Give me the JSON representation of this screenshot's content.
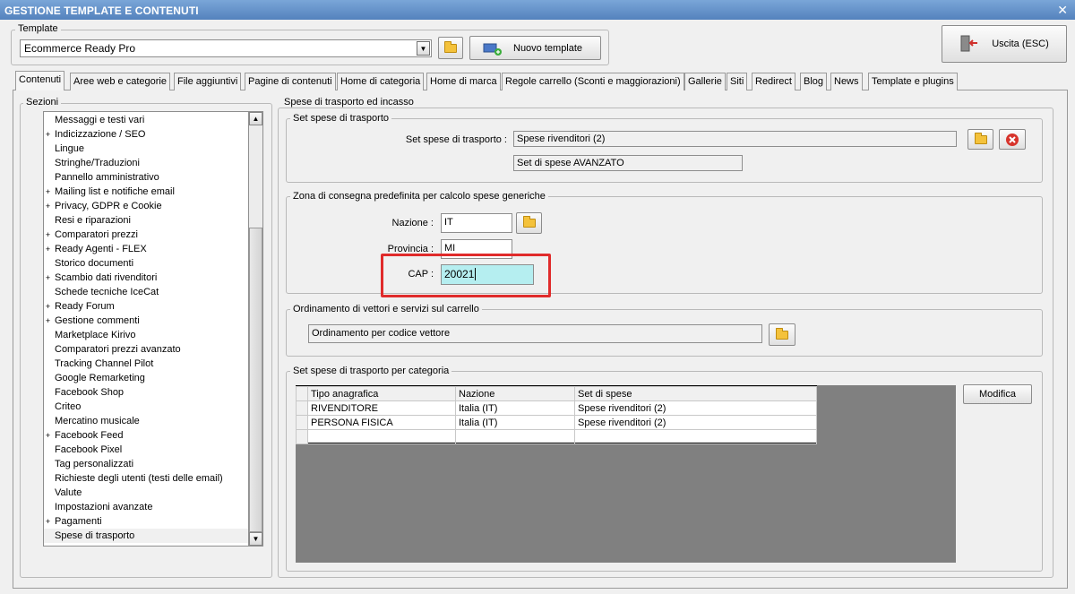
{
  "window": {
    "title": "GESTIONE TEMPLATE E CONTENUTI"
  },
  "template": {
    "group_label": "Template",
    "selected": "Ecommerce Ready Pro",
    "new_button": "Nuovo template"
  },
  "exit_button": "Uscita (ESC)",
  "tabs": [
    "Contenuti",
    "Aree web e categorie",
    "File aggiuntivi",
    "Pagine di contenuti",
    "Home di categoria",
    "Home di marca",
    "Regole carrello (Sconti e maggiorazioni)",
    "Gallerie",
    "Siti",
    "Redirect",
    "Blog",
    "News",
    "Template e plugins"
  ],
  "sections": {
    "label": "Sezioni",
    "items": [
      {
        "label": "Messaggi e testi vari",
        "exp": ""
      },
      {
        "label": "Indicizzazione / SEO",
        "exp": "+"
      },
      {
        "label": "Lingue",
        "exp": ""
      },
      {
        "label": "Stringhe/Traduzioni",
        "exp": ""
      },
      {
        "label": "Pannello amministrativo",
        "exp": ""
      },
      {
        "label": "Mailing list e notifiche email",
        "exp": "+"
      },
      {
        "label": "Privacy, GDPR e Cookie",
        "exp": "+"
      },
      {
        "label": "Resi e riparazioni",
        "exp": ""
      },
      {
        "label": "Comparatori prezzi",
        "exp": "+"
      },
      {
        "label": "Ready Agenti - FLEX",
        "exp": "+"
      },
      {
        "label": "Storico documenti",
        "exp": ""
      },
      {
        "label": "Scambio dati rivenditori",
        "exp": "+"
      },
      {
        "label": "Schede tecniche IceCat",
        "exp": ""
      },
      {
        "label": "Ready Forum",
        "exp": "+"
      },
      {
        "label": "Gestione commenti",
        "exp": "+"
      },
      {
        "label": "Marketplace Kirivo",
        "exp": ""
      },
      {
        "label": "Comparatori prezzi avanzato",
        "exp": ""
      },
      {
        "label": "Tracking Channel Pilot",
        "exp": ""
      },
      {
        "label": "Google Remarketing",
        "exp": ""
      },
      {
        "label": "Facebook Shop",
        "exp": ""
      },
      {
        "label": "Criteo",
        "exp": ""
      },
      {
        "label": "Mercatino musicale",
        "exp": ""
      },
      {
        "label": "Facebook Feed",
        "exp": "+"
      },
      {
        "label": "Facebook Pixel",
        "exp": ""
      },
      {
        "label": "Tag personalizzati",
        "exp": ""
      },
      {
        "label": "Richieste degli utenti (testi delle email)",
        "exp": ""
      },
      {
        "label": "Valute",
        "exp": ""
      },
      {
        "label": "Impostazioni avanzate",
        "exp": ""
      },
      {
        "label": "Pagamenti",
        "exp": "+"
      },
      {
        "label": "Spese di trasporto",
        "exp": ""
      }
    ]
  },
  "shipping": {
    "title": "Spese di trasporto ed incasso",
    "set": {
      "group_label": "Set spese di trasporto",
      "field_label": "Set spese di trasporto :",
      "value": "Spese rivenditori (2)",
      "description": "Set di spese AVANZATO"
    },
    "zone": {
      "group_label": "Zona di consegna predefinita per calcolo spese generiche",
      "nazione_label": "Nazione :",
      "nazione_value": "IT",
      "provincia_label": "Provincia :",
      "provincia_value": "MI",
      "cap_label": "CAP :",
      "cap_value": "20021"
    },
    "ordering": {
      "group_label": "Ordinamento di vettori e servizi sul carrello",
      "value": "Ordinamento per codice vettore"
    },
    "per_category": {
      "group_label": "Set spese di trasporto per categoria",
      "columns": [
        "Tipo anagrafica",
        "Nazione",
        "Set di spese"
      ],
      "rows": [
        [
          "RIVENDITORE",
          "Italia (IT)",
          "Spese rivenditori (2)"
        ],
        [
          "PERSONA FISICA",
          "Italia (IT)",
          "Spese rivenditori (2)"
        ],
        [
          "",
          "",
          ""
        ]
      ],
      "modify_button": "Modifica"
    }
  },
  "colors": {
    "title_bar": "#5f8cc6",
    "cap_highlight": "#b5eef0",
    "callout_red": "#e02b2b",
    "grid_bg": "#808080"
  }
}
